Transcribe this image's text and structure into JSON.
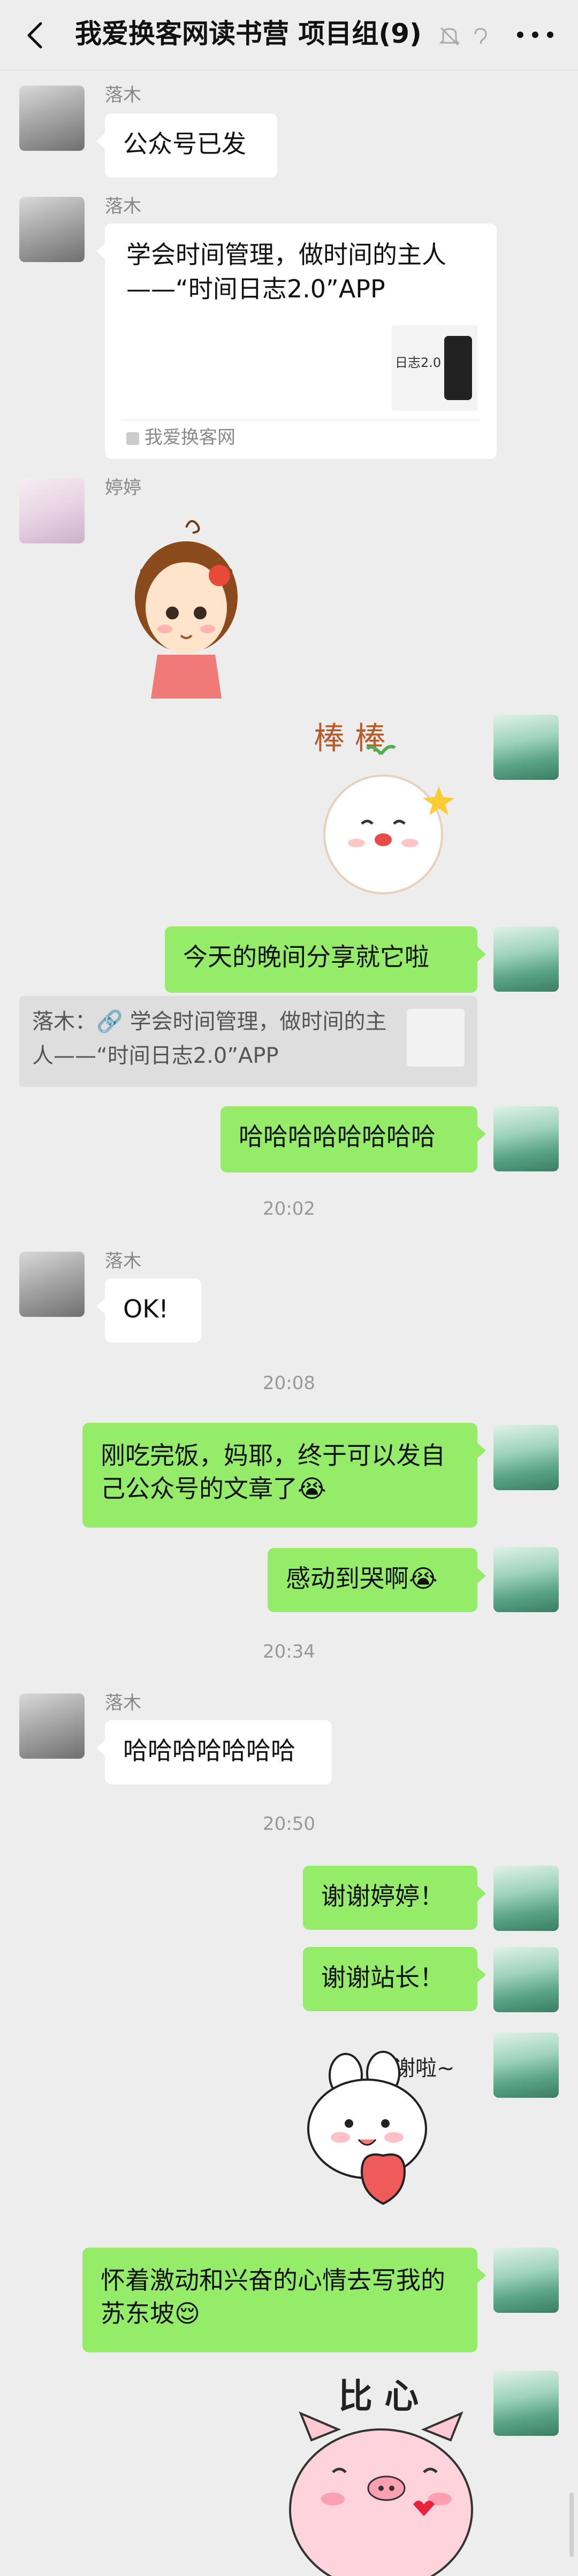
{
  "header": {
    "title": "我爱换客网读书营 项目组(9)",
    "icons": [
      "back-icon",
      "mute-icon",
      "ear-icon",
      "more-icon"
    ]
  },
  "messages": [
    {
      "sender": "落木",
      "text": "公众号已发"
    },
    {
      "sender": "落木",
      "card": {
        "title": "学会时间管理，做时间的主人——“时间日志2.0”APP",
        "thumb_text": "日志2.0",
        "source": "我爱换客网"
      }
    },
    {
      "sender": "婷婷",
      "sticker": "girl-sticker"
    },
    {
      "sticker": "bang-sticker",
      "sticker_text": "棒 棒"
    },
    {
      "text": "今天的晚间分享就它啦"
    },
    {
      "quote": "落木：🔗 学会时间管理，做时间的主人——“时间日志2.0”APP"
    },
    {
      "text": "哈哈哈哈哈哈哈哈"
    },
    {
      "time": "20:02"
    },
    {
      "sender": "落木",
      "text": "OK!"
    },
    {
      "time": "20:08"
    },
    {
      "text": "刚吃完饭，妈耶，终于可以发自己公众号的文章了😭"
    },
    {
      "text": "感动到哭啊😭"
    },
    {
      "time": "20:34"
    },
    {
      "sender": "落木",
      "text": "哈哈哈哈哈哈哈"
    },
    {
      "time": "20:50"
    },
    {
      "text": "谢谢婷婷！"
    },
    {
      "text": "谢谢站长！"
    },
    {
      "sticker": "thanks-sticker",
      "sticker_text": "谢啦~"
    },
    {
      "text": "怀着激动和兴奋的心情去写我的苏东坡😌"
    },
    {
      "sticker": "pig-sticker",
      "sticker_text": "比 心"
    }
  ],
  "colors": {
    "background": "#ededed",
    "green_bubble": "#95ec69",
    "white_bubble": "#ffffff"
  }
}
